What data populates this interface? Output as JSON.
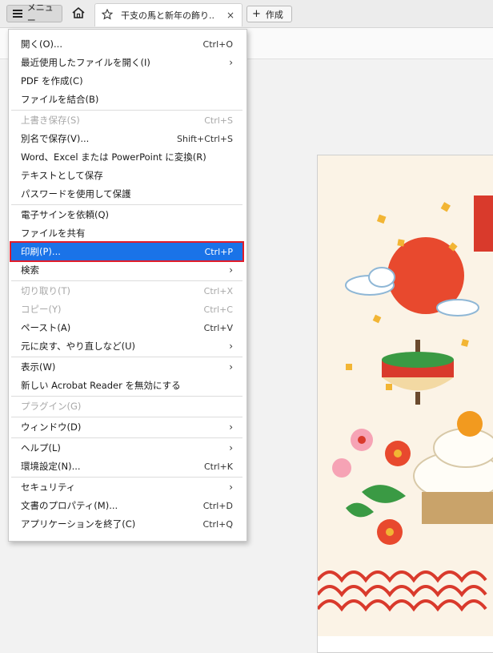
{
  "topbar": {
    "menu_label": "メニュー",
    "tab_title": "干支の馬と新年の飾り....",
    "tab_close": "×",
    "create_label": "作成",
    "create_plus": "+"
  },
  "menu": {
    "items": [
      {
        "label": "開く(O)...",
        "shortcut": "Ctrl+O"
      },
      {
        "label": "最近使用したファイルを開く(I)",
        "shortcut": "›"
      },
      {
        "label": "PDF を作成(C)",
        "shortcut": ""
      },
      {
        "label": "ファイルを結合(B)",
        "shortcut": ""
      },
      {
        "label": "上書き保存(S)",
        "shortcut": "Ctrl+S"
      },
      {
        "label": "別名で保存(V)...",
        "shortcut": "Shift+Ctrl+S"
      },
      {
        "label": "Word、Excel または PowerPoint に変換(R)",
        "shortcut": ""
      },
      {
        "label": "テキストとして保存",
        "shortcut": ""
      },
      {
        "label": "パスワードを使用して保護",
        "shortcut": ""
      },
      {
        "label": "電子サインを依頼(Q)",
        "shortcut": ""
      },
      {
        "label": "ファイルを共有",
        "shortcut": ""
      },
      {
        "label": "印刷(P)...",
        "shortcut": "Ctrl+P"
      },
      {
        "label": "検索",
        "shortcut": "›"
      },
      {
        "label": "切り取り(T)",
        "shortcut": "Ctrl+X"
      },
      {
        "label": "コピー(Y)",
        "shortcut": "Ctrl+C"
      },
      {
        "label": "ペースト(A)",
        "shortcut": "Ctrl+V"
      },
      {
        "label": "元に戻す、やり直しなど(U)",
        "shortcut": "›"
      },
      {
        "label": "表示(W)",
        "shortcut": "›"
      },
      {
        "label": "新しい Acrobat Reader を無効にする",
        "shortcut": ""
      },
      {
        "label": "プラグイン(G)",
        "shortcut": ""
      },
      {
        "label": "ウィンドウ(D)",
        "shortcut": "›"
      },
      {
        "label": "ヘルプ(L)",
        "shortcut": "›"
      },
      {
        "label": "環境設定(N)...",
        "shortcut": "Ctrl+K"
      },
      {
        "label": "セキュリティ",
        "shortcut": "›"
      },
      {
        "label": "文書のプロパティ(M)...",
        "shortcut": "Ctrl+D"
      },
      {
        "label": "アプリケーションを終了(C)",
        "shortcut": "Ctrl+Q"
      }
    ]
  },
  "colors": {
    "highlight": "#1a73e8",
    "highlight_outline": "#e11d2a"
  }
}
